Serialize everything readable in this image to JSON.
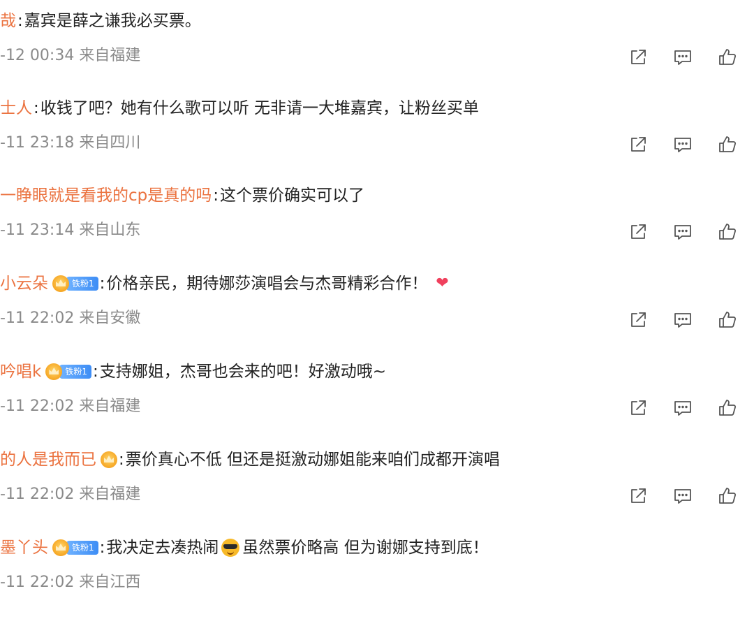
{
  "comments": [
    {
      "user": "哉",
      "separator": ":",
      "text": "嘉宾是薛之谦我必买票。",
      "meta": "-12 00:34 来自福建",
      "badge": null,
      "extra": null
    },
    {
      "user": "士人",
      "separator": ":",
      "text": "收钱了吧？她有什么歌可以听 无非请一大堆嘉宾，让粉丝买单",
      "meta": "-11 23:18 来自四川",
      "badge": null,
      "extra": null
    },
    {
      "user": "一睁眼就是看我的cp是真的吗",
      "separator": ":",
      "text": "这个票价确实可以了",
      "meta": "-11 23:14 来自山东",
      "badge": null,
      "extra": null
    },
    {
      "user": "小云朵",
      "separator": ":",
      "text": "价格亲民，期待娜莎演唱会与杰哥精彩合作！",
      "meta": "-11 22:02 来自安徽",
      "badge": "铁粉1",
      "extra": "heart"
    },
    {
      "user": "吟唱k",
      "separator": ":",
      "text": "支持娜姐，杰哥也会来的吧！好激动哦~",
      "meta": "-11 22:02 来自福建",
      "badge": "铁粉1",
      "extra": null
    },
    {
      "user": "的人是我而已",
      "separator": ":",
      "text": "票价真心不低 但还是挺激动娜姐能来咱们成都开演唱",
      "meta": "-11 22:02 来自福建",
      "badge": "crown-only",
      "extra": null
    },
    {
      "user": "墨丫头",
      "separator": ":",
      "text_before": "我决定去凑热闹",
      "text_after": " 虽然票价略高 但为谢娜支持到底！",
      "meta": "-11 22:02 来自江西",
      "badge": "铁粉1",
      "extra": "sunglasses-emoji"
    }
  ],
  "colors": {
    "username": "#eb7340",
    "meta": "#8a8a8a",
    "text": "#222222",
    "badge": "#3d8df5",
    "heart": "#f0405d"
  },
  "icons": [
    "share-icon",
    "comment-icon",
    "like-icon"
  ]
}
